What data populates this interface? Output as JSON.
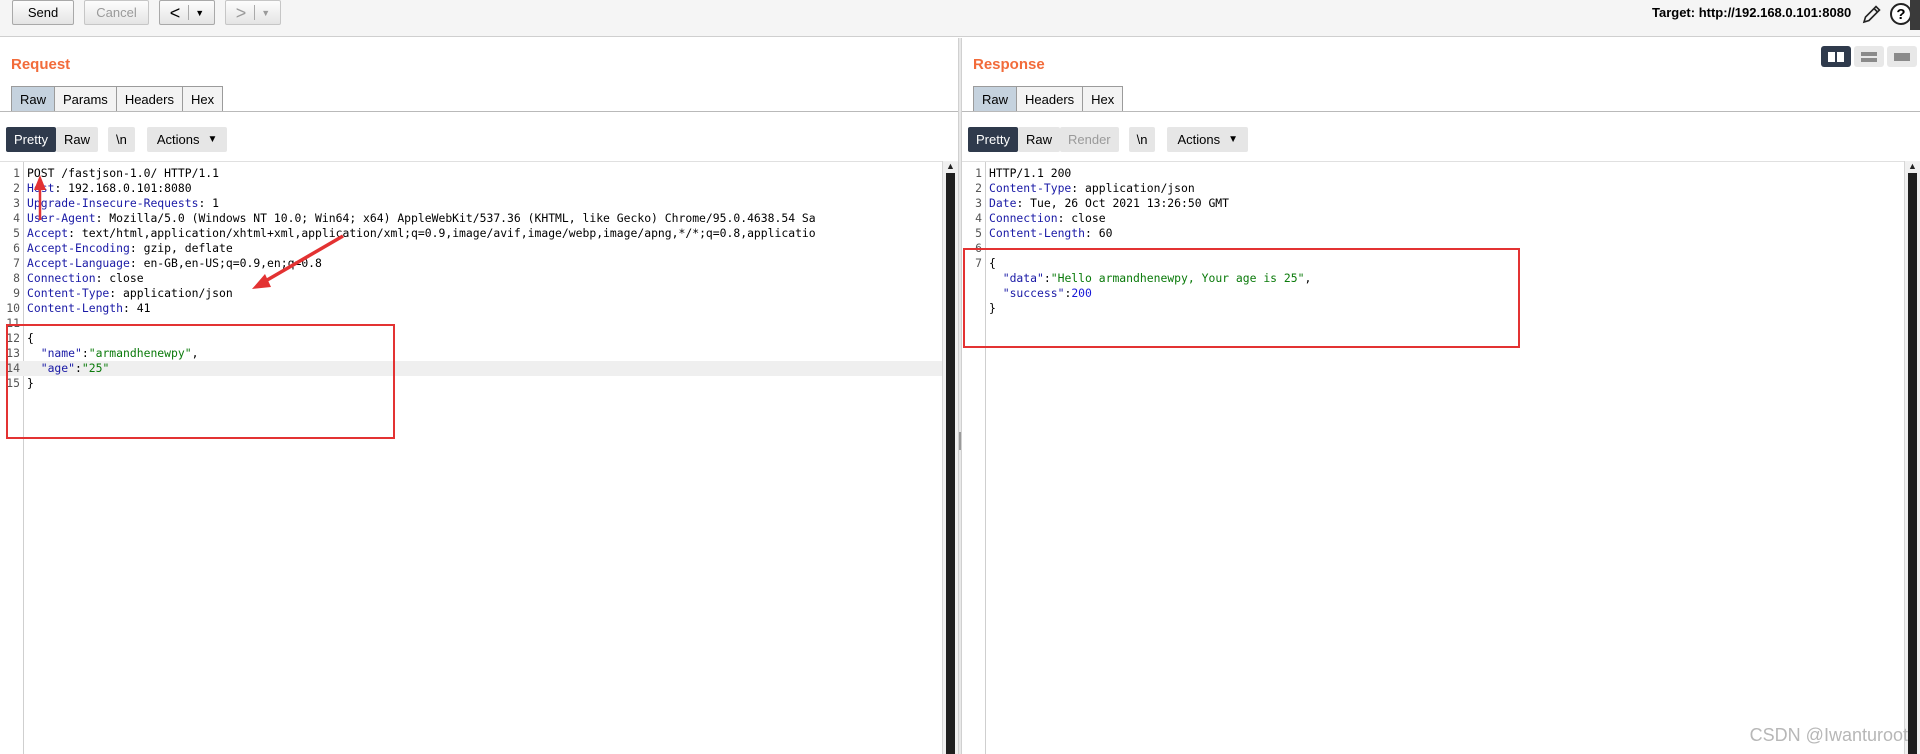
{
  "toolbar": {
    "send_label": "Send",
    "cancel_label": "Cancel",
    "back_label": "<",
    "forward_label": ">",
    "target_text": "Target: http://192.168.0.101:8080"
  },
  "request": {
    "title": "Request",
    "tabs": [
      "Raw",
      "Params",
      "Headers",
      "Hex"
    ],
    "view_buttons": {
      "pretty": "Pretty",
      "raw": "Raw",
      "newline": "\\n",
      "actions": "Actions"
    },
    "lines": [
      {
        "n": "1",
        "key": "",
        "value": "POST /fastjson-1.0/ HTTP/1.1"
      },
      {
        "n": "2",
        "key": "Host",
        "value": " 192.168.0.101:8080"
      },
      {
        "n": "3",
        "key": "Upgrade-Insecure-Requests",
        "value": " 1"
      },
      {
        "n": "4",
        "key": "User-Agent",
        "value": " Mozilla/5.0 (Windows NT 10.0; Win64; x64) AppleWebKit/537.36 (KHTML, like Gecko) Chrome/95.0.4638.54 Sa"
      },
      {
        "n": "5",
        "key": "Accept",
        "value": " text/html,application/xhtml+xml,application/xml;q=0.9,image/avif,image/webp,image/apng,*/*;q=0.8,applicatio"
      },
      {
        "n": "6",
        "key": "Accept-Encoding",
        "value": " gzip, deflate"
      },
      {
        "n": "7",
        "key": "Accept-Language",
        "value": " en-GB,en-US;q=0.9,en;q=0.8"
      },
      {
        "n": "8",
        "key": "Connection",
        "value": " close"
      },
      {
        "n": "9",
        "key": "Content-Type",
        "value": " application/json"
      },
      {
        "n": "10",
        "key": "Content-Length",
        "value": " 41"
      },
      {
        "n": "11",
        "key": "",
        "value": ""
      },
      {
        "n": "12",
        "key": "",
        "value": "{"
      },
      {
        "n": "13",
        "jkey": "\"name\"",
        "jval": "\"armandhenewpy\"",
        "tail": ","
      },
      {
        "n": "14",
        "jkey": "\"age\"",
        "jval": "\"25\"",
        "tail": ""
      },
      {
        "n": "15",
        "key": "",
        "value": "}"
      }
    ]
  },
  "response": {
    "title": "Response",
    "tabs": [
      "Raw",
      "Headers",
      "Hex"
    ],
    "view_buttons": {
      "pretty": "Pretty",
      "raw": "Raw",
      "render": "Render",
      "newline": "\\n",
      "actions": "Actions"
    },
    "lines": [
      {
        "n": "1",
        "key": "",
        "value": "HTTP/1.1 200"
      },
      {
        "n": "2",
        "key": "Content-Type",
        "value": " application/json"
      },
      {
        "n": "3",
        "key": "Date",
        "value": " Tue, 26 Oct 2021 13:26:50 GMT"
      },
      {
        "n": "4",
        "key": "Connection",
        "value": " close"
      },
      {
        "n": "5",
        "key": "Content-Length",
        "value": " 60"
      },
      {
        "n": "6",
        "key": "",
        "value": ""
      },
      {
        "n": "7",
        "key": "",
        "value": "{"
      },
      {
        "n": "",
        "jkey": "\"data\"",
        "jval": "\"Hello armandhenewpy, Your age is 25\"",
        "tail": ","
      },
      {
        "n": "",
        "jkey": "\"success\"",
        "jnum": "200",
        "tail": ""
      },
      {
        "n": "",
        "key": "",
        "value": "}"
      }
    ]
  },
  "watermark": "CSDN @Iwanturoot",
  "colors": {
    "accent_title": "#f26b3a",
    "active_tab": "#c5d2de",
    "active_pill": "#2f3a4c",
    "annotation_red": "#e33232"
  }
}
